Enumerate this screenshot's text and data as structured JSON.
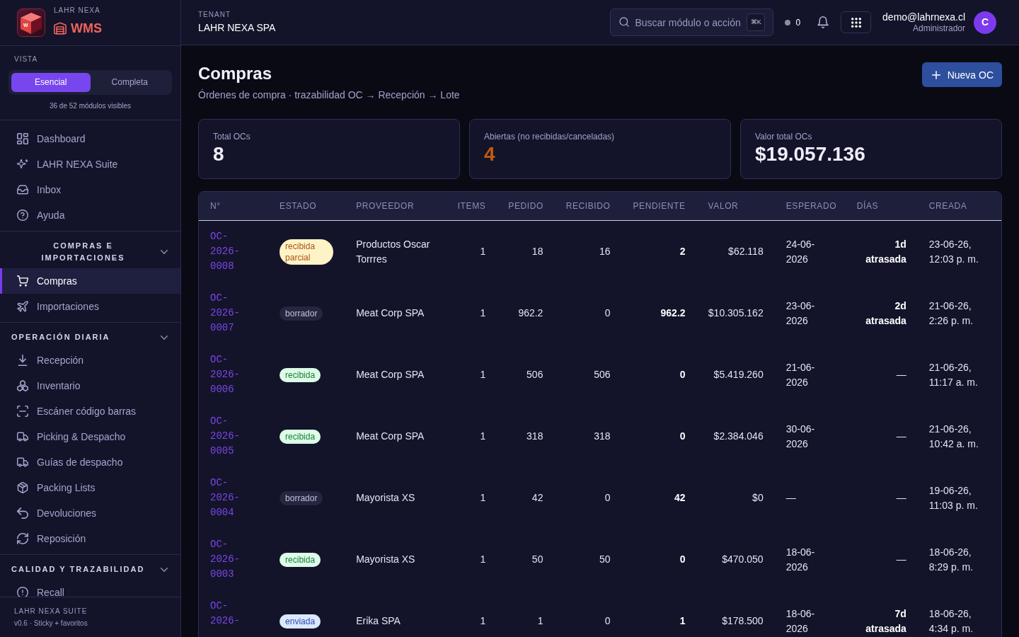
{
  "sidebar": {
    "brand": {
      "logo_letter": "W",
      "overline": "LAHR NEXA",
      "product": "WMS"
    },
    "view": {
      "label": "VISTA",
      "options": [
        {
          "label": "Esencial",
          "selected": true
        },
        {
          "label": "Completa",
          "selected": false
        }
      ],
      "note": "36 de 52 módulos visibles"
    },
    "groups": [
      {
        "items": [
          {
            "label": "Dashboard",
            "selected": false
          },
          {
            "label": "LAHR NEXA Suite",
            "selected": false
          },
          {
            "label": "Inbox",
            "selected": false
          },
          {
            "label": "Ayuda",
            "selected": false
          }
        ]
      },
      {
        "title": "COMPRAS E IMPORTACIONES",
        "expanded": true,
        "items": [
          {
            "label": "Compras",
            "selected": true
          },
          {
            "label": "Importaciones",
            "selected": false
          }
        ]
      },
      {
        "title": "OPERACIÓN DIARIA",
        "expanded": true,
        "items": [
          {
            "label": "Recepción",
            "selected": false
          },
          {
            "label": "Inventario",
            "selected": false
          },
          {
            "label": "Escáner código barras",
            "selected": false
          },
          {
            "label": "Picking & Despacho",
            "selected": false
          },
          {
            "label": "Guías de despacho",
            "selected": false
          },
          {
            "label": "Packing Lists",
            "selected": false
          },
          {
            "label": "Devoluciones",
            "selected": false
          },
          {
            "label": "Reposición",
            "selected": false
          }
        ]
      },
      {
        "title": "CALIDAD Y TRAZABILIDAD",
        "expanded": true,
        "items": [
          {
            "label": "Recall",
            "selected": false
          }
        ]
      }
    ],
    "footer": {
      "title": "LAHR NEXA SUITE",
      "version": "v0.6 · Sticky + favoritos"
    }
  },
  "topbar": {
    "tenant_label": "TENANT",
    "tenant": "LAHR NEXA SPA",
    "search": {
      "placeholder": "Buscar módulo o acción",
      "shortcut": "⌘K"
    },
    "status_count": "0",
    "user": {
      "email": "demo@lahrnexa.cl",
      "role": "Administrador",
      "initial": "C"
    }
  },
  "page": {
    "title": "Compras",
    "subtitle": "Órdenes de compra · trazabilidad OC → Recepción → Lote",
    "primary_action": "Nueva OC"
  },
  "stats": [
    {
      "label": "Total OCs",
      "value": "8",
      "color": "#eeedf8"
    },
    {
      "label": "Abiertas (no recibidas/canceladas)",
      "value": "4",
      "color": "#c4590d"
    },
    {
      "label": "Valor total OCs",
      "value": "$19.057.136",
      "color": "#eeedf8"
    }
  ],
  "table": {
    "columns": [
      "N°",
      "ESTADO",
      "PROVEEDOR",
      "ITEMS",
      "PEDIDO",
      "RECIBIDO",
      "PENDIENTE",
      "VALOR",
      "ESPERADO",
      "DÍAS",
      "CREADA"
    ],
    "rows": [
      {
        "number": "OC-2026-0008",
        "status": {
          "label": "recibida parcial",
          "kind": "partial"
        },
        "supplier": "Productos Oscar Torrres",
        "items": "1",
        "ordered": "18",
        "received": "16",
        "pending": "2",
        "value": "$62.118",
        "expected": "24-06-2026",
        "days": {
          "text": "1d atrasada",
          "overdue": true
        },
        "created": "23-06-26, 12:03 p. m."
      },
      {
        "number": "OC-2026-0007",
        "status": {
          "label": "borrador",
          "kind": "draft"
        },
        "supplier": "Meat Corp SPA",
        "items": "1",
        "ordered": "962.2",
        "received": "0",
        "pending": "962.2",
        "value": "$10.305.162",
        "expected": "23-06-2026",
        "days": {
          "text": "2d atrasada",
          "overdue": true
        },
        "created": "21-06-26, 2:26 p. m."
      },
      {
        "number": "OC-2026-0006",
        "status": {
          "label": "recibida",
          "kind": "received"
        },
        "supplier": "Meat Corp SPA",
        "items": "1",
        "ordered": "506",
        "received": "506",
        "pending": "0",
        "value": "$5.419.260",
        "expected": "21-06-2026",
        "days": {
          "text": "—",
          "overdue": false
        },
        "created": "21-06-26, 11:17 a. m."
      },
      {
        "number": "OC-2026-0005",
        "status": {
          "label": "recibida",
          "kind": "received"
        },
        "supplier": "Meat Corp SPA",
        "items": "1",
        "ordered": "318",
        "received": "318",
        "pending": "0",
        "value": "$2.384.046",
        "expected": "30-06-2026",
        "days": {
          "text": "—",
          "overdue": false
        },
        "created": "21-06-26, 10:42 a. m."
      },
      {
        "number": "OC-2026-0004",
        "status": {
          "label": "borrador",
          "kind": "draft"
        },
        "supplier": "Mayorista XS",
        "items": "1",
        "ordered": "42",
        "received": "0",
        "pending": "42",
        "value": "$0",
        "expected": "—",
        "days": {
          "text": "—",
          "overdue": false
        },
        "created": "19-06-26, 11:03 p. m."
      },
      {
        "number": "OC-2026-0003",
        "status": {
          "label": "recibida",
          "kind": "received"
        },
        "supplier": "Mayorista XS",
        "items": "1",
        "ordered": "50",
        "received": "50",
        "pending": "0",
        "value": "$470.050",
        "expected": "18-06-2026",
        "days": {
          "text": "—",
          "overdue": false
        },
        "created": "18-06-26, 8:29 p. m."
      },
      {
        "number": "OC-2026-",
        "status": {
          "label": "enviada",
          "kind": "sent"
        },
        "supplier": "Erika SPA",
        "items": "1",
        "ordered": "1",
        "received": "0",
        "pending": "1",
        "value": "$178.500",
        "expected": "18-06-2026",
        "days": {
          "text": "7d atrasada",
          "overdue": true
        },
        "created": "18-06-26, 4:34 p. m."
      }
    ]
  }
}
